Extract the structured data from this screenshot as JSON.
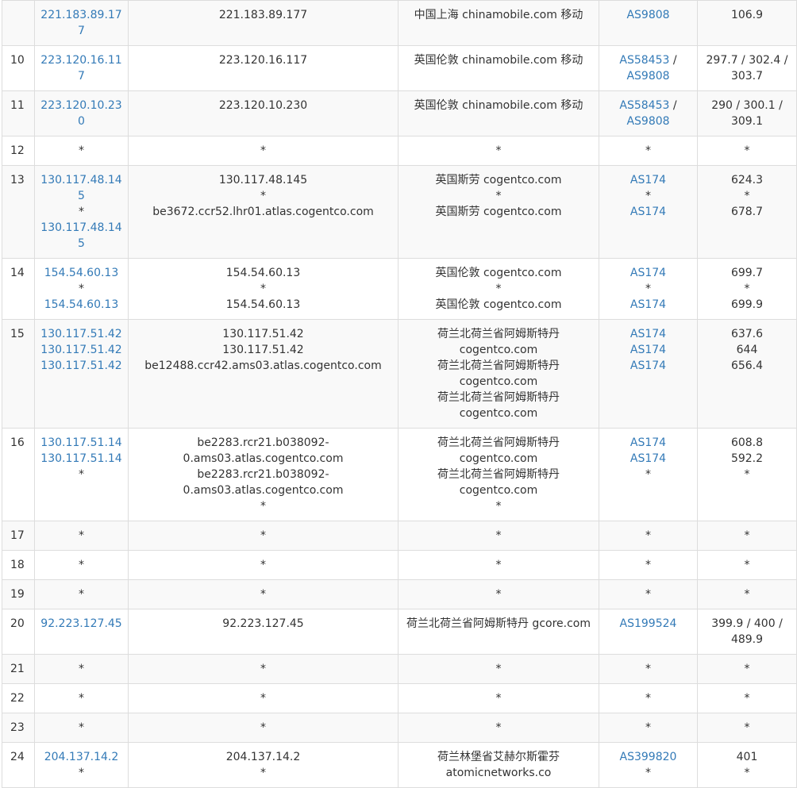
{
  "rows": [
    {
      "hop": "",
      "ip": [
        "221.183.89.177"
      ],
      "host": [
        "221.183.89.177"
      ],
      "location": [
        "中国上海 chinamobile.com 移动"
      ],
      "asn": [
        "AS9808"
      ],
      "latency": [
        "106.9"
      ]
    },
    {
      "hop": "10",
      "ip": [
        "223.120.16.117"
      ],
      "host": [
        "223.120.16.117"
      ],
      "location": [
        "英国伦敦 chinamobile.com 移动"
      ],
      "asn": [
        "AS58453",
        "/",
        "AS9808"
      ],
      "latency": [
        "297.7 / 302.4 / 303.7"
      ]
    },
    {
      "hop": "11",
      "ip": [
        "223.120.10.230"
      ],
      "host": [
        "223.120.10.230"
      ],
      "location": [
        "英国伦敦 chinamobile.com 移动"
      ],
      "asn": [
        "AS58453",
        "/",
        "AS9808"
      ],
      "latency": [
        "290 / 300.1 / 309.1"
      ]
    },
    {
      "hop": "12",
      "ip": [
        "*"
      ],
      "host": [
        "*"
      ],
      "location": [
        "*"
      ],
      "asn": [
        "*"
      ],
      "latency": [
        "*"
      ]
    },
    {
      "hop": "13",
      "ip": [
        "130.117.48.145",
        "*",
        "130.117.48.145"
      ],
      "host": [
        "130.117.48.145",
        "*",
        "be3672.ccr52.lhr01.atlas.cogentco.com"
      ],
      "location": [
        "英国斯劳 cogentco.com",
        "*",
        "英国斯劳 cogentco.com"
      ],
      "asn": [
        "AS174",
        "*",
        "AS174"
      ],
      "latency": [
        "624.3",
        "*",
        "678.7"
      ]
    },
    {
      "hop": "14",
      "ip": [
        "154.54.60.13",
        "*",
        "154.54.60.13"
      ],
      "host": [
        "154.54.60.13",
        "*",
        "154.54.60.13"
      ],
      "location": [
        "英国伦敦 cogentco.com",
        "*",
        "英国伦敦 cogentco.com"
      ],
      "asn": [
        "AS174",
        "*",
        "AS174"
      ],
      "latency": [
        "699.7",
        "*",
        "699.9"
      ]
    },
    {
      "hop": "15",
      "ip": [
        "130.117.51.42",
        "130.117.51.42",
        "130.117.51.42"
      ],
      "host": [
        "130.117.51.42",
        "130.117.51.42",
        "be12488.ccr42.ams03.atlas.cogentco.com"
      ],
      "location": [
        "荷兰北荷兰省阿姆斯特丹 cogentco.com",
        "荷兰北荷兰省阿姆斯特丹 cogentco.com",
        "荷兰北荷兰省阿姆斯特丹 cogentco.com"
      ],
      "asn": [
        "AS174",
        "AS174",
        "AS174"
      ],
      "latency": [
        "637.6",
        "644",
        "656.4"
      ]
    },
    {
      "hop": "16",
      "ip": [
        "130.117.51.14",
        "130.117.51.14",
        "*"
      ],
      "host": [
        "be2283.rcr21.b038092-0.ams03.atlas.cogentco.com",
        "be2283.rcr21.b038092-0.ams03.atlas.cogentco.com",
        "*"
      ],
      "location": [
        "荷兰北荷兰省阿姆斯特丹 cogentco.com",
        "荷兰北荷兰省阿姆斯特丹 cogentco.com",
        "*"
      ],
      "asn": [
        "AS174",
        "AS174",
        "*"
      ],
      "latency": [
        "608.8",
        "592.2",
        "*"
      ]
    },
    {
      "hop": "17",
      "ip": [
        "*"
      ],
      "host": [
        "*"
      ],
      "location": [
        "*"
      ],
      "asn": [
        "*"
      ],
      "latency": [
        "*"
      ]
    },
    {
      "hop": "18",
      "ip": [
        "*"
      ],
      "host": [
        "*"
      ],
      "location": [
        "*"
      ],
      "asn": [
        "*"
      ],
      "latency": [
        "*"
      ]
    },
    {
      "hop": "19",
      "ip": [
        "*"
      ],
      "host": [
        "*"
      ],
      "location": [
        "*"
      ],
      "asn": [
        "*"
      ],
      "latency": [
        "*"
      ]
    },
    {
      "hop": "20",
      "ip": [
        "92.223.127.45"
      ],
      "host": [
        "92.223.127.45"
      ],
      "location": [
        "荷兰北荷兰省阿姆斯特丹 gcore.com"
      ],
      "asn": [
        "AS199524"
      ],
      "latency": [
        "399.9 / 400 / 489.9"
      ]
    },
    {
      "hop": "21",
      "ip": [
        "*"
      ],
      "host": [
        "*"
      ],
      "location": [
        "*"
      ],
      "asn": [
        "*"
      ],
      "latency": [
        "*"
      ]
    },
    {
      "hop": "22",
      "ip": [
        "*"
      ],
      "host": [
        "*"
      ],
      "location": [
        "*"
      ],
      "asn": [
        "*"
      ],
      "latency": [
        "*"
      ]
    },
    {
      "hop": "23",
      "ip": [
        "*"
      ],
      "host": [
        "*"
      ],
      "location": [
        "*"
      ],
      "asn": [
        "*"
      ],
      "latency": [
        "*"
      ]
    },
    {
      "hop": "24",
      "ip": [
        "204.137.14.2",
        "*"
      ],
      "host": [
        "204.137.14.2",
        "*"
      ],
      "location": [
        "荷兰林堡省艾赫尔斯霍芬 atomicnetworks.co"
      ],
      "asn": [
        "AS399820",
        "*"
      ],
      "latency": [
        "401",
        "*"
      ]
    }
  ]
}
